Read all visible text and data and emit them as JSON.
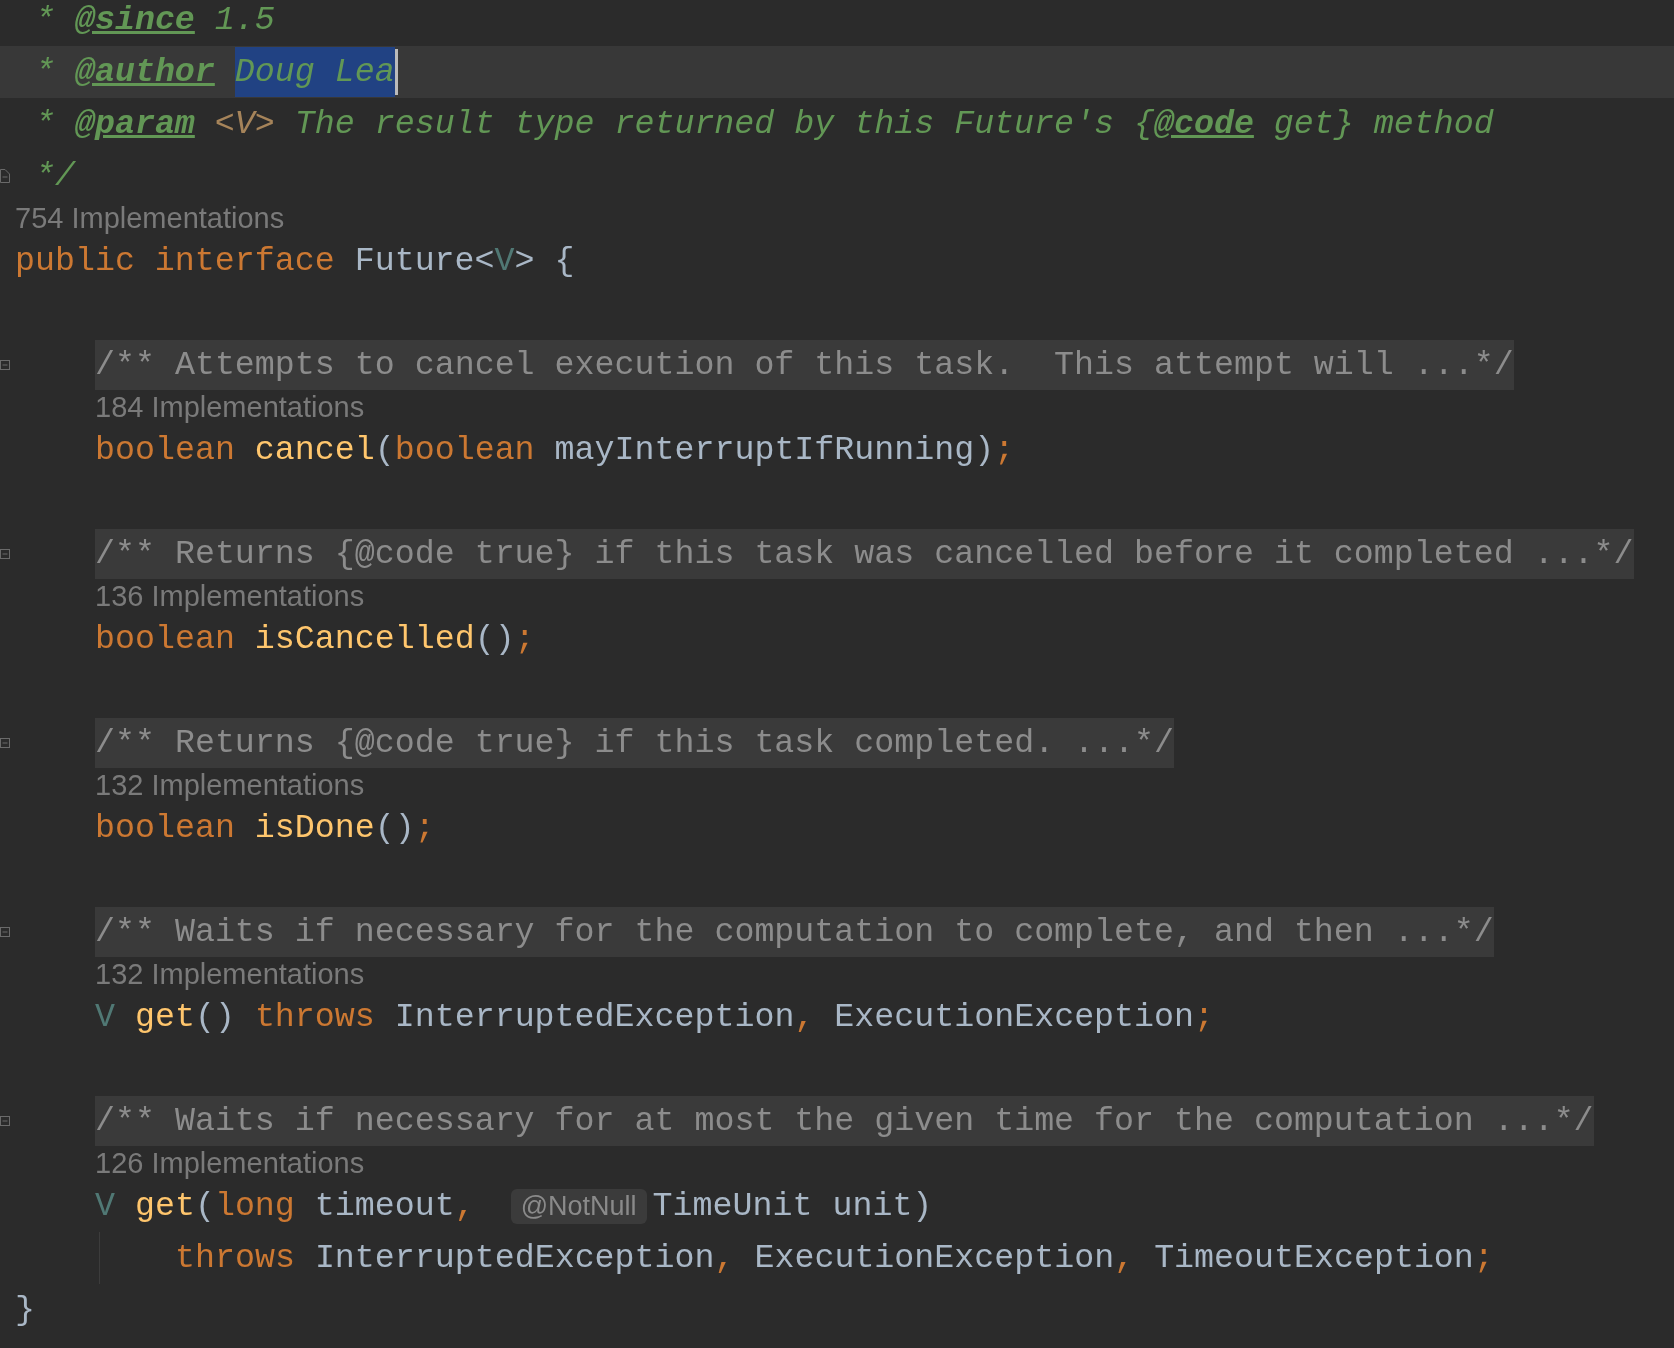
{
  "editor": {
    "lines": [
      {
        "kind": "code",
        "tokens": [
          {
            "text": " * ",
            "kind": "doc"
          },
          {
            "text": "@since",
            "kind": "doctag"
          },
          {
            "text": " 1.5",
            "kind": "doc"
          }
        ]
      },
      {
        "kind": "code",
        "current": true,
        "caret": true,
        "tokens": [
          {
            "text": " * ",
            "kind": "doc"
          },
          {
            "text": "@author",
            "kind": "doctag"
          },
          {
            "text": "Doug Lea",
            "kind": "selected"
          }
        ]
      },
      {
        "kind": "code",
        "tokens": [
          {
            "text": " * ",
            "kind": "doc"
          },
          {
            "text": "@param",
            "kind": "doctag"
          },
          {
            "text": " <V>",
            "kind": "docparam"
          },
          {
            "text": " The result type returned by this Future's {",
            "kind": "doc"
          },
          {
            "text": "@code",
            "kind": "doctag"
          },
          {
            "text": " get} method",
            "kind": "doc"
          }
        ]
      },
      {
        "kind": "code",
        "fold_end": true,
        "tokens": [
          {
            "text": " */",
            "kind": "doc"
          }
        ]
      },
      {
        "kind": "hint",
        "text": "754 Implementations"
      },
      {
        "kind": "code",
        "tokens": [
          {
            "text": "public interface ",
            "kind": "keyword"
          },
          {
            "text": "Future<",
            "kind": "ident"
          },
          {
            "text": "V",
            "kind": "typevar"
          },
          {
            "text": "> {",
            "kind": "ident"
          }
        ],
        "children": [
          {
            "kind": "blank"
          },
          {
            "kind": "code",
            "collapsed": true,
            "tokens": [
              {
                "text": "/** Attempts to cancel execution of this task.  This attempt will ...*/",
                "kind": "folded"
              }
            ]
          },
          {
            "kind": "hint",
            "text": "184 Implementations"
          },
          {
            "kind": "code",
            "tokens": [
              {
                "text": "boolean ",
                "kind": "keyword"
              },
              {
                "text": "cancel",
                "kind": "method"
              },
              {
                "text": "(",
                "kind": "ident"
              },
              {
                "text": "boolean ",
                "kind": "keyword"
              },
              {
                "text": "mayInterruptIfRunning)",
                "kind": "ident"
              },
              {
                "text": ";",
                "kind": "keyword"
              }
            ]
          },
          {
            "kind": "blank"
          },
          {
            "kind": "code",
            "collapsed": true,
            "tokens": [
              {
                "text": "/** Returns {@code true} if this task was cancelled before it completed ...*/",
                "kind": "folded"
              }
            ]
          },
          {
            "kind": "hint",
            "text": "136 Implementations"
          },
          {
            "kind": "code",
            "tokens": [
              {
                "text": "boolean ",
                "kind": "keyword"
              },
              {
                "text": "isCancelled",
                "kind": "method"
              },
              {
                "text": "()",
                "kind": "ident"
              },
              {
                "text": ";",
                "kind": "keyword"
              }
            ]
          },
          {
            "kind": "blank"
          },
          {
            "kind": "code",
            "collapsed": true,
            "tokens": [
              {
                "text": "/** Returns {@code true} if this task completed. ...*/",
                "kind": "folded"
              }
            ]
          },
          {
            "kind": "hint",
            "text": "132 Implementations"
          },
          {
            "kind": "code",
            "tokens": [
              {
                "text": "boolean ",
                "kind": "keyword"
              },
              {
                "text": "isDone",
                "kind": "method"
              },
              {
                "text": "()",
                "kind": "ident"
              },
              {
                "text": ";",
                "kind": "keyword"
              }
            ]
          },
          {
            "kind": "blank"
          },
          {
            "kind": "code",
            "collapsed": true,
            "tokens": [
              {
                "text": "/** Waits if necessary for the computation to complete, and then ...*/",
                "kind": "folded"
              }
            ]
          },
          {
            "kind": "hint",
            "text": "132 Implementations"
          },
          {
            "kind": "code",
            "tokens": [
              {
                "text": "V ",
                "kind": "typevar"
              },
              {
                "text": "get",
                "kind": "method"
              },
              {
                "text": "() ",
                "kind": "ident"
              },
              {
                "text": "throws ",
                "kind": "keyword"
              },
              {
                "text": "InterruptedException",
                "kind": "ident"
              },
              {
                "text": ", ",
                "kind": "keyword"
              },
              {
                "text": "ExecutionException",
                "kind": "ident"
              },
              {
                "text": ";",
                "kind": "keyword"
              }
            ]
          },
          {
            "kind": "blank"
          },
          {
            "kind": "code",
            "collapsed": true,
            "tokens": [
              {
                "text": "/** Waits if necessary for at most the given time for the computation ...*/",
                "kind": "folded"
              }
            ]
          },
          {
            "kind": "hint",
            "text": "126 Implementations"
          },
          {
            "kind": "code",
            "tokens": [
              {
                "text": "V ",
                "kind": "typevar"
              },
              {
                "text": "get",
                "kind": "method"
              },
              {
                "text": "(",
                "kind": "ident"
              },
              {
                "text": "long ",
                "kind": "keyword"
              },
              {
                "text": "timeout",
                "kind": "ident"
              },
              {
                "text": ", ",
                "kind": "keyword"
              },
              {
                "text": "@NotNull",
                "kind": "inlay"
              },
              {
                "text": "TimeUnit unit)",
                "kind": "ident"
              }
            ],
            "children": [
              {
                "kind": "code",
                "tokens": [
                  {
                    "text": "throws ",
                    "kind": "keyword"
                  },
                  {
                    "text": "InterruptedException",
                    "kind": "ident"
                  },
                  {
                    "text": ", ",
                    "kind": "keyword"
                  },
                  {
                    "text": "ExecutionException",
                    "kind": "ident"
                  },
                  {
                    "text": ", ",
                    "kind": "keyword"
                  },
                  {
                    "text": "TimeoutException",
                    "kind": "ident"
                  },
                  {
                    "text": ";",
                    "kind": "keyword"
                  }
                ]
              }
            ]
          }
        ]
      },
      {
        "kind": "code",
        "tokens": [
          {
            "text": "}",
            "kind": "ident"
          }
        ]
      }
    ]
  }
}
